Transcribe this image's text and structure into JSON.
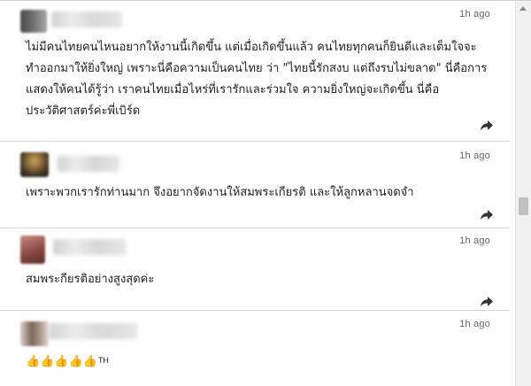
{
  "comments": [
    {
      "time": "1h ago",
      "text": "ไม่มีคนไทยคนไหนอยากให้งานนี้เกิดขึ้น แต่เมื่อเกิดขึ้นแล้ว คนไทยทุกคนก็ยินดีและเต็มใจจะทำออกมาให้ยิ่งใหญ่ เพราะนี่คือความเป็นคนไทย ว่า \"ไทยนี้รักสงบ แต่ถึงรบไม่ขลาด\" นี่คือการแสดงให้คนได้รู้ว่า เราคนไทยเมื่อไหร่ที่เรารักและร่วมใจ ความยิ่งใหญ่จะเกิดขึ้น นี่คือประวัติศาสตร์ค่ะพี่เบิร์ด",
      "share_icon": "share-arrow-icon",
      "avatar_colors": [
        "#4a4a4a",
        "#9a9a9a"
      ]
    },
    {
      "time": "1h ago",
      "text": "เพราะพวกเรารักท่านมาก จึงอยากจัดงานให้สมพระเกียรติ และให้ลูกหลานจดจำ",
      "share_icon": "share-arrow-icon",
      "avatar_colors": [
        "#3b2f22",
        "#c8a25a"
      ]
    },
    {
      "time": "1h ago",
      "text": "สมพระกียรติอย่างสูงสุดค่ะ",
      "share_icon": "share-arrow-icon",
      "avatar_colors": [
        "#8a4a44",
        "#c78b7f"
      ]
    },
    {
      "time": "1h ago",
      "emoji": "👍👍👍👍👍",
      "emoji_suffix": "TH",
      "avatar_colors": [
        "#7a6a60",
        "#d9d0c8"
      ]
    }
  ],
  "scrollbar": {
    "up_icon": "scroll-up-arrow-icon",
    "thumb_position": 0.52
  },
  "colors": {
    "text": "#222222",
    "meta": "#666666",
    "divider": "#d9d9d9",
    "icon": "#333333"
  }
}
